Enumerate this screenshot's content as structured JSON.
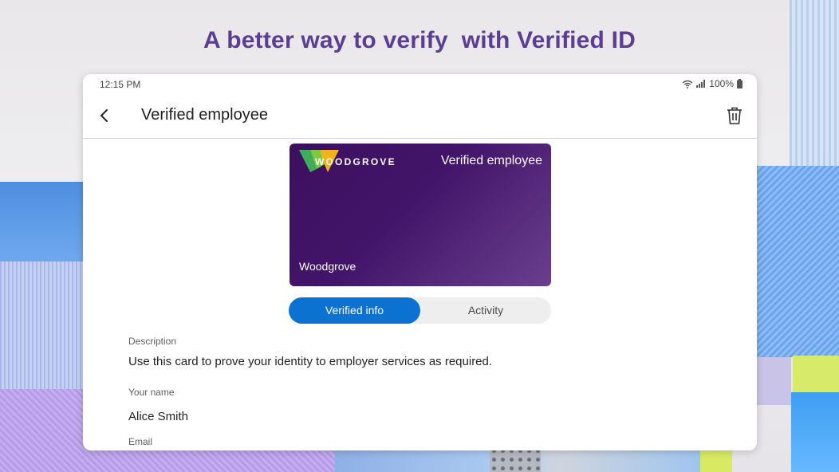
{
  "headline": "A better way to verify  with Verified ID",
  "status_bar": {
    "time": "12:15 PM",
    "battery": "100%"
  },
  "app_bar": {
    "title": "Verified employee"
  },
  "card": {
    "brand": "WOODGROVE",
    "type": "Verified employee",
    "issuer": "Woodgrove"
  },
  "tabs": [
    {
      "label": "Verified info",
      "selected": true
    },
    {
      "label": "Activity",
      "selected": false
    }
  ],
  "fields": [
    {
      "label": "Description",
      "value": "Use this card to prove your identity to employer services as required."
    },
    {
      "label": "Your name",
      "value": "Alice Smith"
    },
    {
      "label": "Email",
      "value": ""
    }
  ],
  "colors": {
    "headline": "#5b3d93",
    "accent": "#0b72d1",
    "card": "#3c0f5f"
  },
  "icons": [
    "wifi-icon",
    "signal-icon",
    "battery-icon",
    "back-arrow-icon",
    "trash-icon",
    "woodgrove-logo-icon"
  ]
}
